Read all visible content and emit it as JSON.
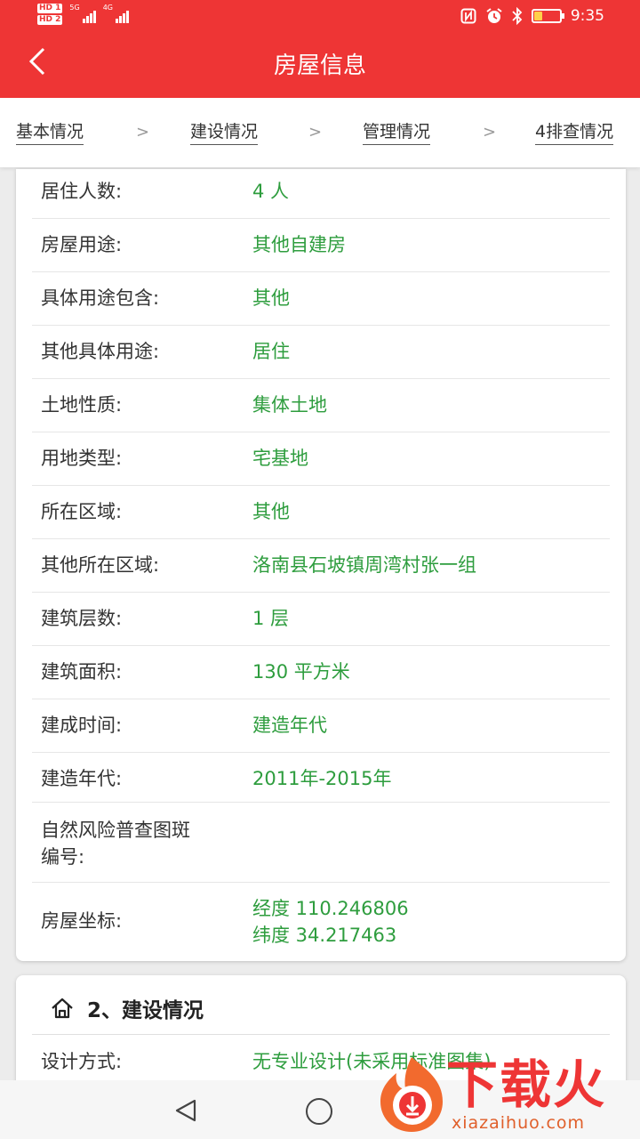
{
  "status_bar": {
    "sim1": "HD 1",
    "sim2": "HD 2",
    "net1": "5G",
    "net2": "4G",
    "time": "9:35",
    "battery_level": 0.3
  },
  "app_bar": {
    "title": "房屋信息"
  },
  "steps": [
    {
      "label": "基本情况"
    },
    {
      "label": "建设情况"
    },
    {
      "label": "管理情况"
    },
    {
      "label": "4排查情况"
    }
  ],
  "step_separator": ">",
  "basic_info": {
    "rows": [
      {
        "label": "居住人数:",
        "value": "4 人"
      },
      {
        "label": "房屋用途:",
        "value": "其他自建房"
      },
      {
        "label": "具体用途包含:",
        "value": "其他"
      },
      {
        "label": "其他具体用途:",
        "value": "居住"
      },
      {
        "label": "土地性质:",
        "value": "集体土地"
      },
      {
        "label": "用地类型:",
        "value": "宅基地"
      },
      {
        "label": "所在区域:",
        "value": "其他"
      },
      {
        "label": "其他所在区域:",
        "value": "洛南县石坡镇周湾村张一组"
      },
      {
        "label": "建筑层数:",
        "value": "1 层"
      },
      {
        "label": "建筑面积:",
        "value": "130 平方米"
      },
      {
        "label": "建成时间:",
        "value": "建造年代"
      },
      {
        "label": "建造年代:",
        "value": "2011年-2015年"
      }
    ],
    "map_id_label_line1": "自然风险普查图斑",
    "map_id_label_line2": "编号:",
    "coord_label": "房屋坐标:",
    "longitude": "经度 110.246806",
    "latitude": "纬度 34.217463"
  },
  "construction": {
    "title": "2、建设情况",
    "rows": [
      {
        "label": "设计方式:",
        "value": "无专业设计(未采用标准图集)"
      }
    ]
  },
  "watermark": {
    "brand": "下载火",
    "domain": "xiazaihuo.com"
  },
  "colors": {
    "primary": "#ee3535",
    "value_green": "#2e9d3e"
  }
}
